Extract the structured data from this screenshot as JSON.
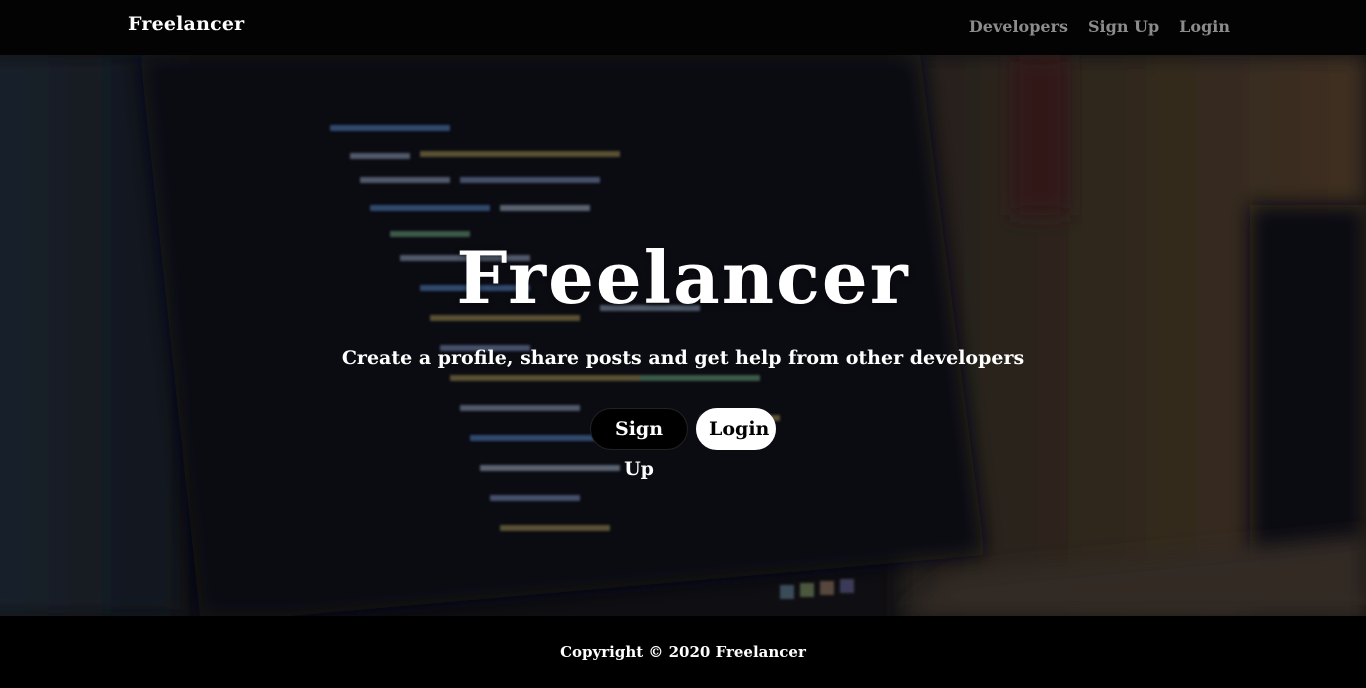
{
  "navbar": {
    "brand": "Freelancer",
    "links": [
      {
        "label": "Developers"
      },
      {
        "label": "Sign Up"
      },
      {
        "label": "Login"
      }
    ]
  },
  "hero": {
    "title": "Freelancer",
    "lead": "Create a profile, share posts and get help from other developers",
    "buttons": {
      "signup_label": "Sign Up",
      "login_label": "Login"
    },
    "background": "blurred-laptop-code-photo"
  },
  "footer": {
    "copyright": "Copyright © 2020 Freelancer"
  },
  "colors": {
    "navbar_bg": "#030303",
    "nav_link": "#8c8c8c",
    "footer_bg": "#000000",
    "btn_dark_bg": "#000000",
    "btn_light_bg": "#ffffff"
  }
}
